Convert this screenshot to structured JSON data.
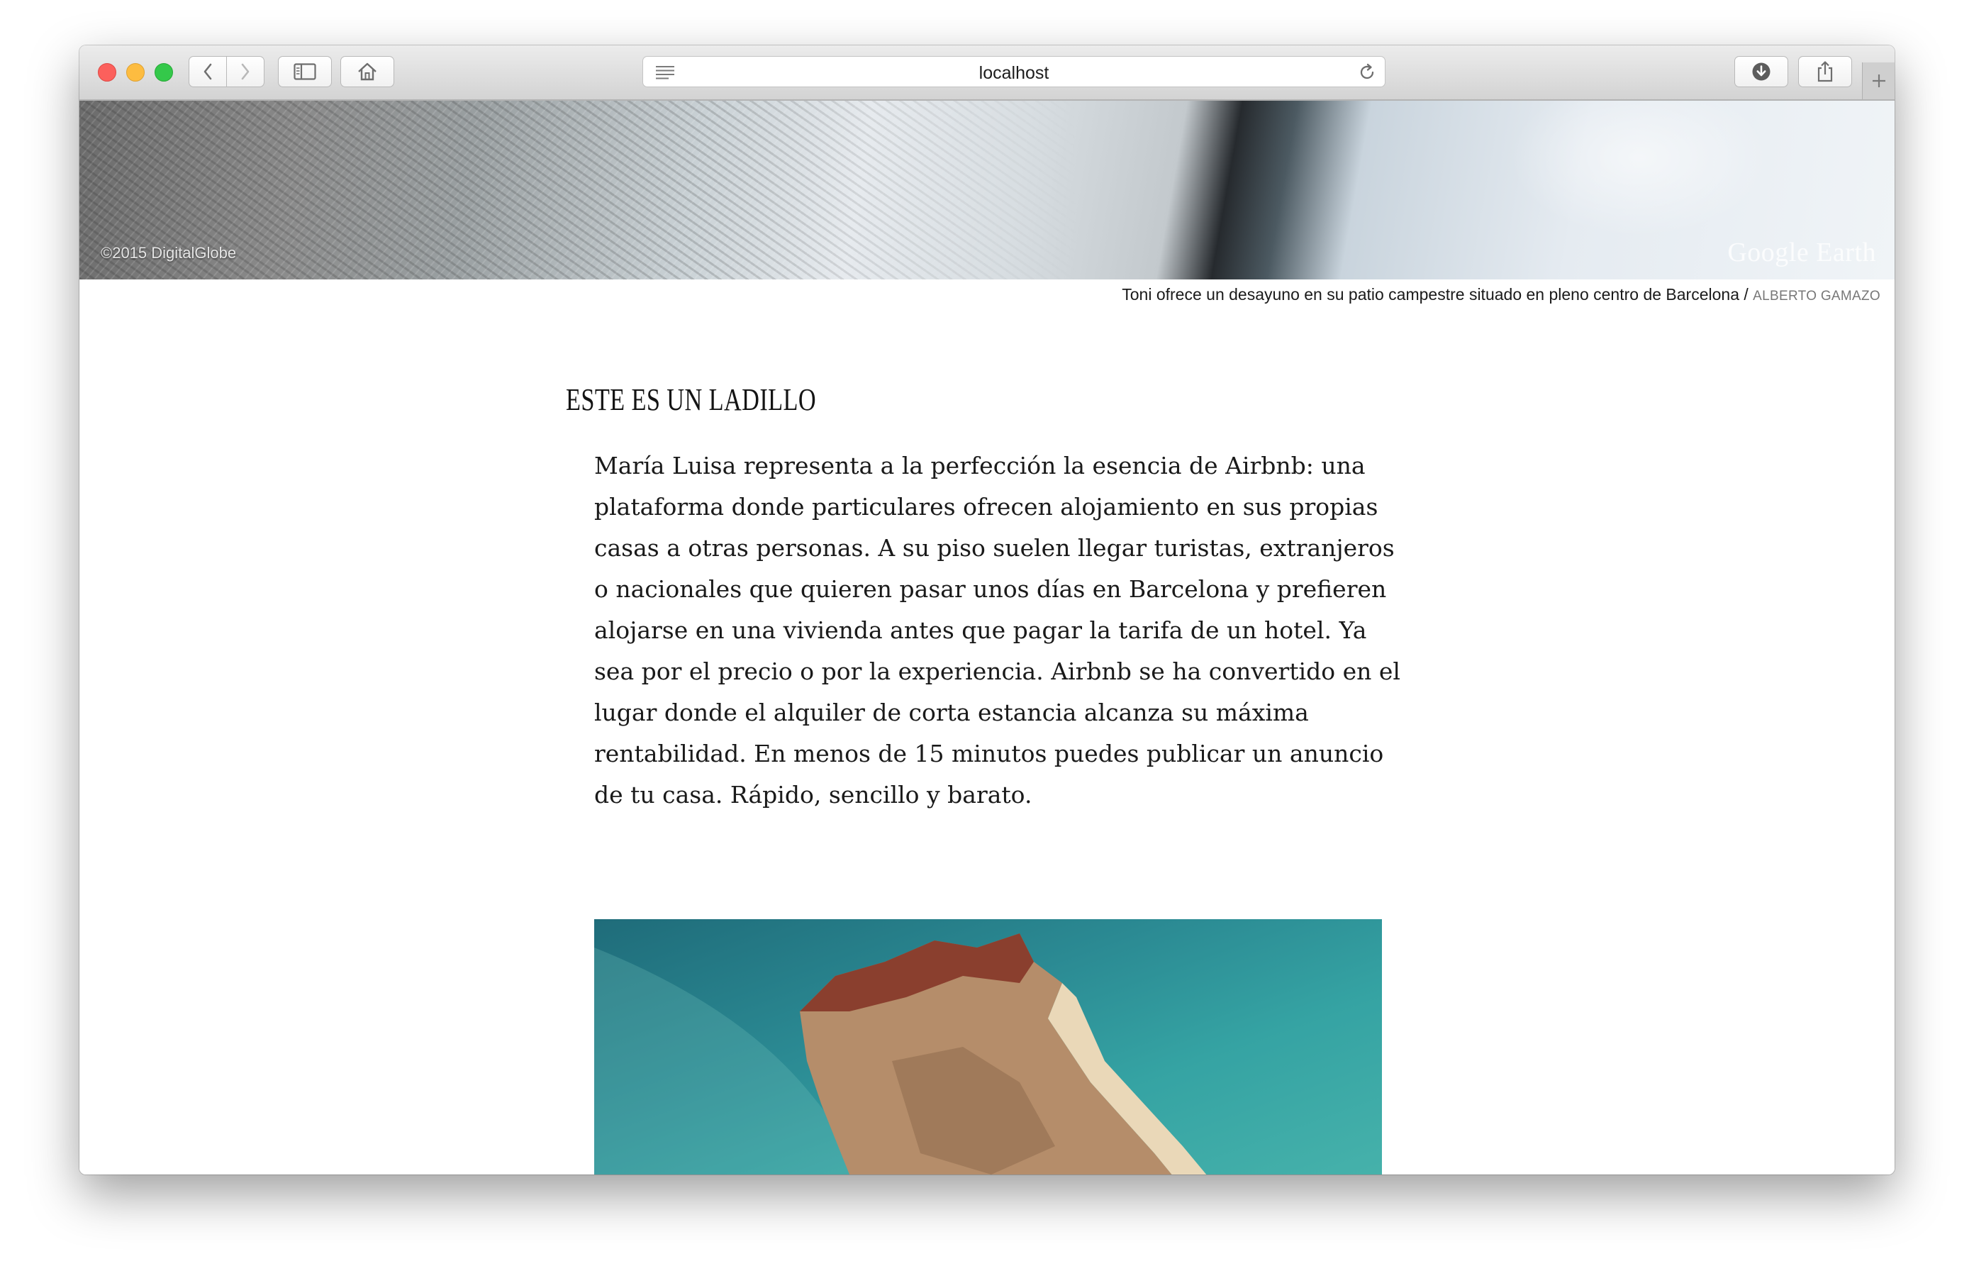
{
  "browser": {
    "url": "localhost",
    "icons": {
      "back": "chevron-left-icon",
      "forward": "chevron-right-icon",
      "sidebar": "sidebar-icon",
      "home": "home-icon",
      "reader": "reader-icon",
      "reload": "reload-icon",
      "downloads": "download-icon",
      "share": "share-icon",
      "new_tab": "plus-icon"
    }
  },
  "hero": {
    "copyright": "©2015 DigitalGlobe",
    "logo": "Google Earth",
    "caption": "Toni ofrece un desayuno en su patio campestre situado en pleno centro de Barcelona /",
    "credit": "ALBERTO GAMAZO"
  },
  "article": {
    "ladillo": "ESTE ES UN LADILLO",
    "paragraph": "María Luisa representa a la perfección la esencia de Airbnb: una plataforma donde particulares ofrecen alojamiento en sus propias casas a otras personas. A su piso suelen llegar turistas, extranjeros o nacionales que quieren pasar unos días en Barcelona y prefieren alojarse en una vivienda antes que pagar la tarifa de un hotel. Ya sea por el precio o por la experiencia. Airbnb se ha convertido en el lugar donde el alquiler de corta estancia alcanza su máxima rentabilidad. En menos de 15 minutos puedes publicar un anuncio de tu casa. Rápido, sencillo y barato."
  }
}
